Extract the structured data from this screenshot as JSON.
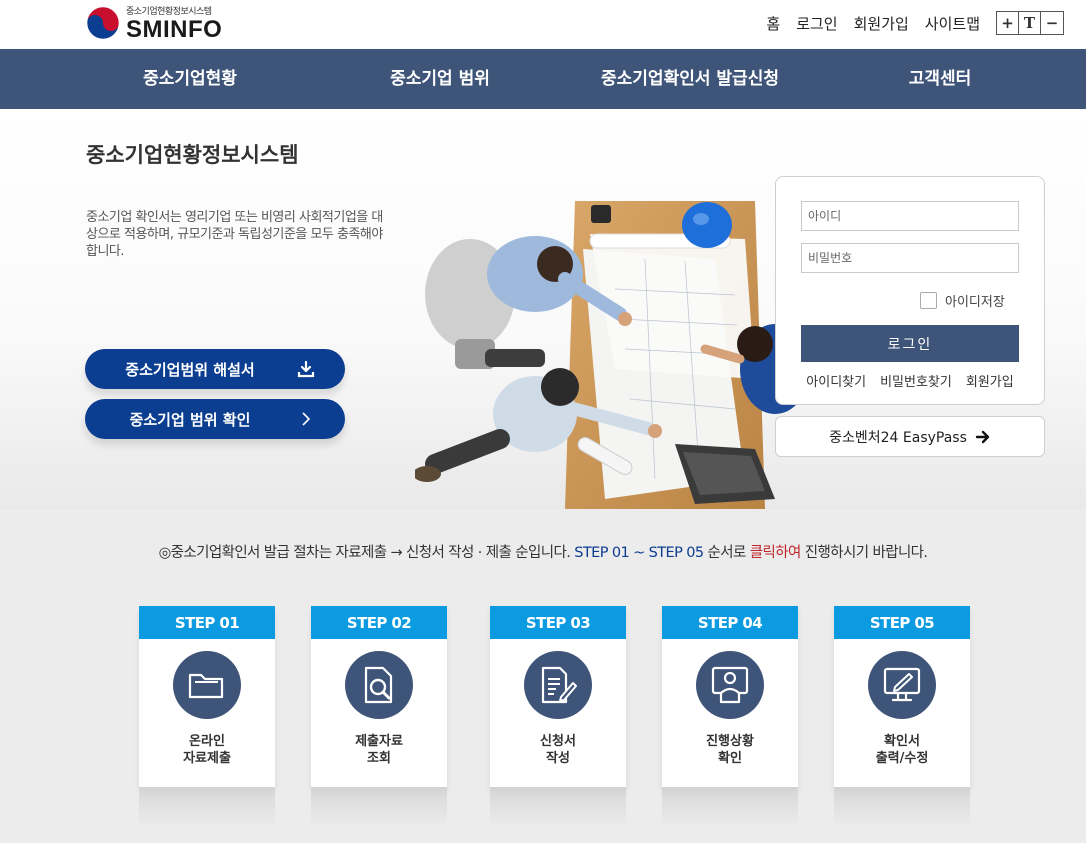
{
  "header": {
    "logo_sub": "중소기업현황정보시스템",
    "logo_main": "SMINFO",
    "util_links": [
      "홈",
      "로그인",
      "회원가입",
      "사이트맵"
    ],
    "font_controls": [
      "+",
      "T",
      "−"
    ]
  },
  "nav": {
    "items": [
      "중소기업현황",
      "중소기업 범위",
      "중소기업확인서 발급신청",
      "고객센터"
    ]
  },
  "hero": {
    "title": "중소기업현황정보시스템",
    "description": "중소기업 확인서는 영리기업 또는 비영리 사회적기업을 대상으로 적용하며, 규모기준과 독립성기준을 모두 충족해야 합니다.",
    "button_guide": "중소기업범위 해설서",
    "button_check": "중소기업 범위 확인"
  },
  "login": {
    "id_placeholder": "아이디",
    "pw_placeholder": "비밀번호",
    "save_id": "아이디저장",
    "login_button": "로그인",
    "links": [
      "아이디찾기",
      "비밀번호찾기",
      "회원가입"
    ],
    "easypass": "중소벤처24 EasyPass"
  },
  "notice": {
    "part1": "◎중소기업확인서 발급 절차는 자료제출 → 신청서 작성 · 제출 순입니다.",
    "part2": "STEP 01 ~ STEP 05",
    "part3": "순서로",
    "part4": "클릭하여",
    "part5": "진행하시기 바랍니다."
  },
  "steps": [
    {
      "head": "STEP 01",
      "label": "온라인\n자료제출",
      "icon": "folder-icon"
    },
    {
      "head": "STEP 02",
      "label": "제출자료\n조회",
      "icon": "document-search-icon"
    },
    {
      "head": "STEP 03",
      "label": "신청서\n작성",
      "icon": "document-edit-icon"
    },
    {
      "head": "STEP 04",
      "label": "진행상황\n확인",
      "icon": "monitor-user-icon"
    },
    {
      "head": "STEP 05",
      "label": "확인서\n출력/수정",
      "icon": "monitor-pen-icon"
    }
  ],
  "colors": {
    "nav_bg": "#3e5478",
    "pill_bg": "#0b3d91",
    "step_head": "#0c9be0",
    "highlight_blue": "#0b3d91",
    "highlight_red": "#c0272d"
  }
}
